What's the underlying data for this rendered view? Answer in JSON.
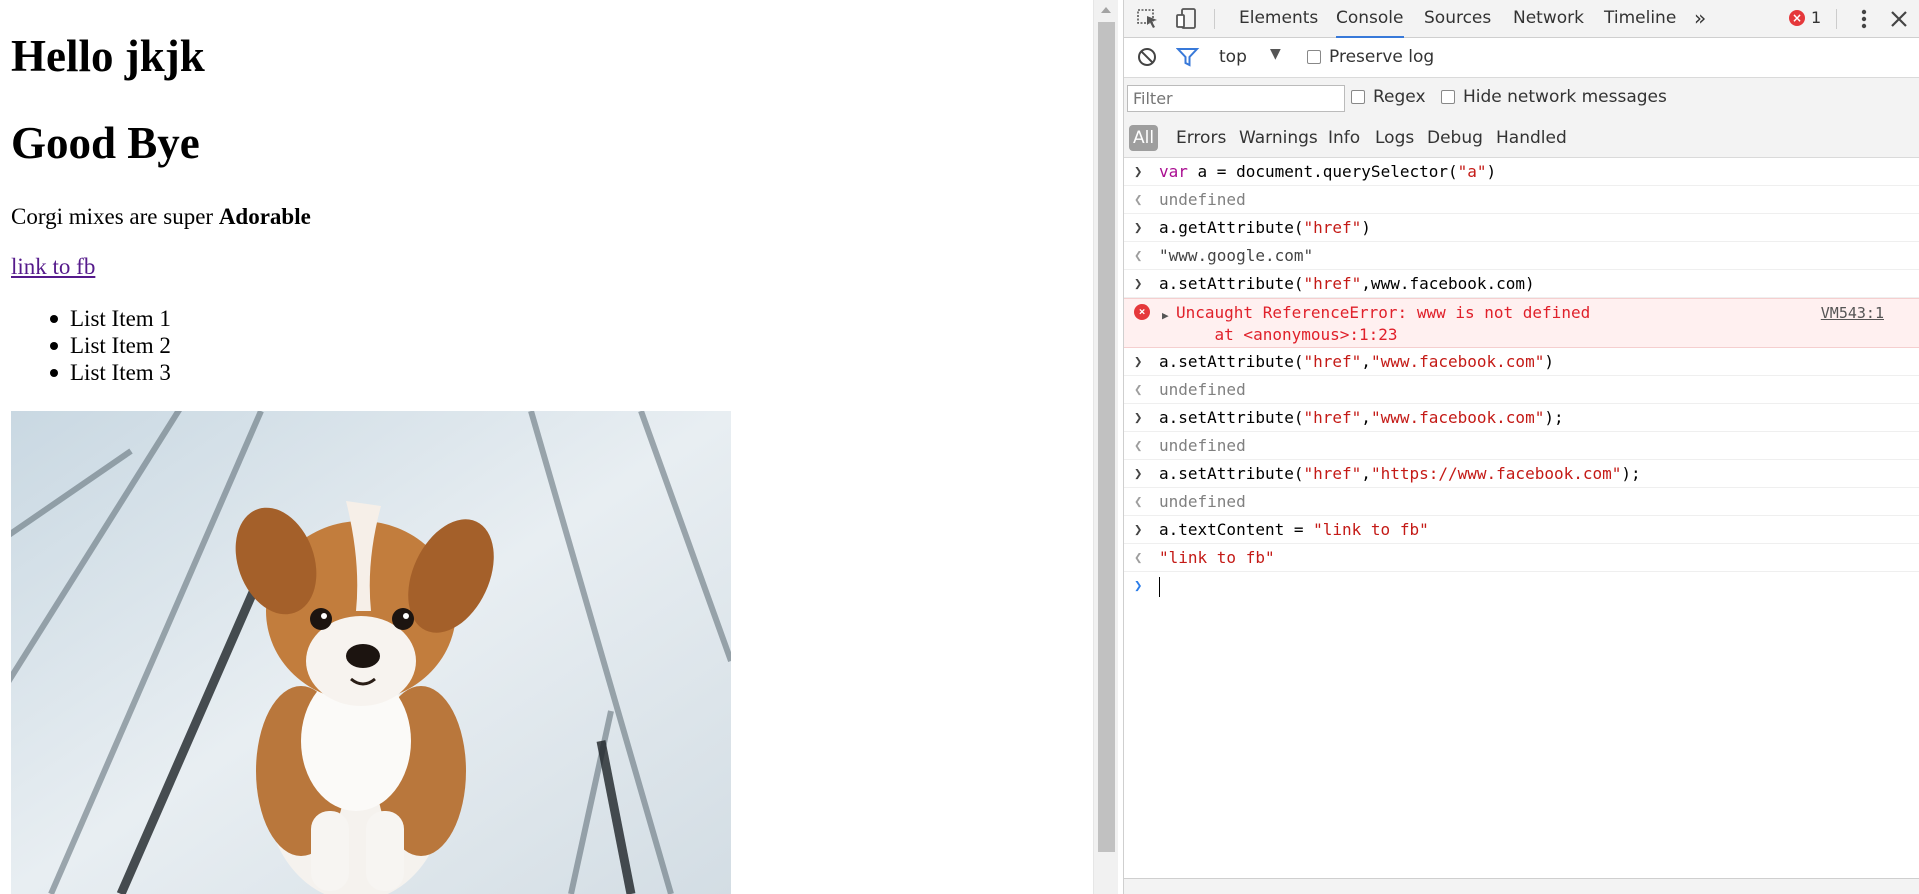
{
  "page": {
    "heading1": "Hello jkjk",
    "heading2": "Good Bye",
    "paragraph_text": "Corgi mixes are super ",
    "paragraph_bold": "Adorable",
    "link_text": "link to fb",
    "list_items": [
      "List Item 1",
      "List Item 2",
      "List Item 3"
    ]
  },
  "devtools": {
    "tabs": [
      "Elements",
      "Console",
      "Sources",
      "Network",
      "Timeline"
    ],
    "active_tab": "Console",
    "more_tabs": "»",
    "error_count": "1",
    "context": "top",
    "preserve_log": "Preserve log",
    "filter_placeholder": "Filter",
    "regex": "Regex",
    "hide_network": "Hide network messages",
    "levels": [
      "All",
      "Errors",
      "Warnings",
      "Info",
      "Logs",
      "Debug",
      "Handled"
    ],
    "accent": "#3879d9",
    "error_color": "#e5383b"
  },
  "console": {
    "l1": {
      "kw": "var",
      "rest1": " a = document.querySelector(",
      "str": "\"a\"",
      "rest2": ")"
    },
    "o1": "undefined",
    "l2": {
      "a": "a.getAttribute(",
      "str": "\"href\"",
      "b": ")"
    },
    "o2": "\"www.google.com\"",
    "l3": {
      "a": "a.setAttribute(",
      "str": "\"href\"",
      "b": ",www.facebook.com)"
    },
    "error_line1": "Uncaught ReferenceError: www is not defined",
    "error_line2": "    at <anonymous>:1:23",
    "error_source": "VM543:1",
    "l4": {
      "a": "a.setAttribute(",
      "s1": "\"href\"",
      "c": ",",
      "s2": "\"www.facebook.com\"",
      "b": ")"
    },
    "o4": "undefined",
    "l5": {
      "a": "a.setAttribute(",
      "s1": "\"href\"",
      "c": ",",
      "s2": "\"www.facebook.com\"",
      "b": ");"
    },
    "o5": "undefined",
    "l6": {
      "a": "a.setAttribute(",
      "s1": "\"href\"",
      "c": ",",
      "s2": "\"https://www.facebook.com\"",
      "b": ");"
    },
    "o6": "undefined",
    "l7": {
      "a": "a.textContent = ",
      "str": "\"link to fb\""
    },
    "o7": "\"link to fb\""
  }
}
